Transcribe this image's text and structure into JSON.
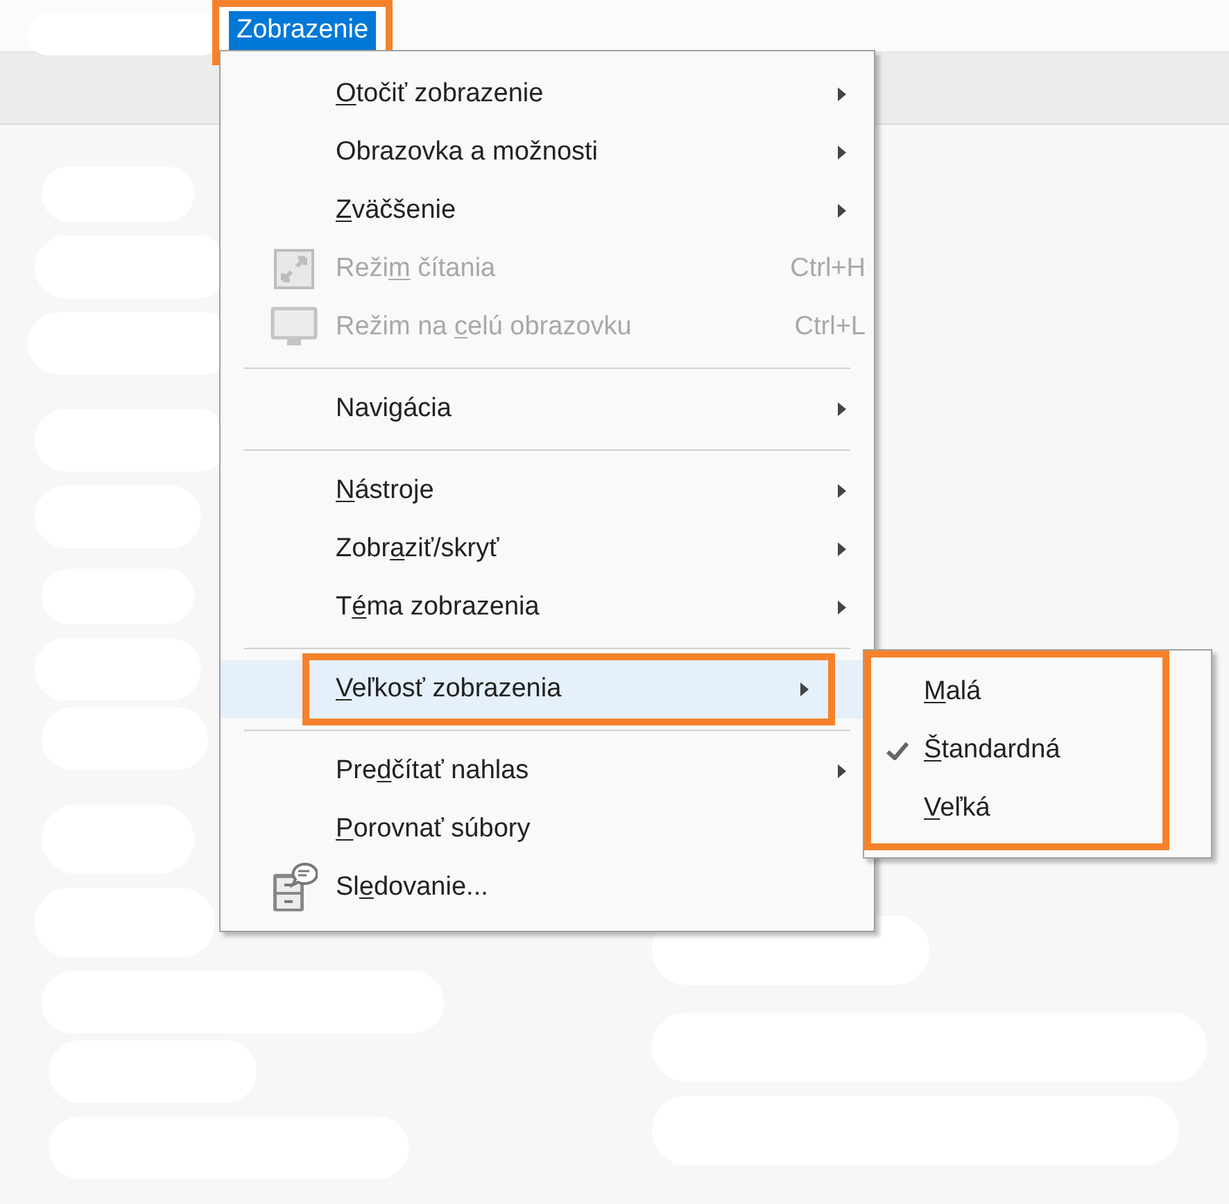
{
  "menu_bar": {
    "items": [
      {
        "label": "Zobrazenie",
        "selected": true,
        "annotated": true
      }
    ]
  },
  "menu": {
    "items": [
      {
        "kind": "item",
        "label_parts": {
          "key": "O",
          "after": "točiť zobrazenie"
        },
        "submenu": true,
        "disabled": false,
        "selected": false
      },
      {
        "kind": "item",
        "label_parts": {
          "before": "Obrazovka a možnosti"
        },
        "submenu": true,
        "disabled": false,
        "selected": false
      },
      {
        "kind": "item",
        "label_parts": {
          "key": "Z",
          "after": "väčšenie"
        },
        "submenu": true,
        "disabled": false,
        "selected": false
      },
      {
        "kind": "item",
        "label_parts": {
          "before": "Reži",
          "key": "m",
          "after": " čítania"
        },
        "shortcut": "Ctrl+H",
        "submenu": false,
        "disabled": true,
        "selected": false
      },
      {
        "kind": "item",
        "label_parts": {
          "before": "Režim na ",
          "key": "c",
          "after": "elú obrazovku"
        },
        "shortcut": "Ctrl+L",
        "submenu": false,
        "disabled": true,
        "selected": false
      },
      {
        "kind": "separator"
      },
      {
        "kind": "item",
        "label_parts": {
          "before": "Navi",
          "key": "g",
          "after": "ácia"
        },
        "submenu": true,
        "disabled": false,
        "selected": false
      },
      {
        "kind": "separator"
      },
      {
        "kind": "item",
        "label_parts": {
          "key": "N",
          "after": "ástroje"
        },
        "submenu": true,
        "disabled": false,
        "selected": false
      },
      {
        "kind": "item",
        "label_parts": {
          "before": "Zobr",
          "key": "a",
          "after": "ziť/skryť"
        },
        "submenu": true,
        "disabled": false,
        "selected": false
      },
      {
        "kind": "item",
        "label_parts": {
          "before": "T",
          "key": "é",
          "after": "ma zobrazenia"
        },
        "submenu": true,
        "disabled": false,
        "selected": false
      },
      {
        "kind": "separator"
      },
      {
        "kind": "item",
        "label_parts": {
          "key": "V",
          "after": "eľkosť zobrazenia"
        },
        "submenu": true,
        "disabled": false,
        "selected": true,
        "annotated": true
      },
      {
        "kind": "separator"
      },
      {
        "kind": "item",
        "label_parts": {
          "before": "Pre",
          "key": "d",
          "after": "čítať nahlas"
        },
        "submenu": true,
        "disabled": false,
        "selected": false
      },
      {
        "kind": "item",
        "label_parts": {
          "key": "P",
          "after": "orovnať súbory"
        },
        "submenu": false,
        "disabled": false,
        "selected": false
      },
      {
        "kind": "item",
        "label_parts": {
          "before": "Sl",
          "key": "e",
          "after": "dovanie..."
        },
        "submenu": false,
        "disabled": false,
        "selected": false
      }
    ]
  },
  "submenu": {
    "annotated": true,
    "items": [
      {
        "label_parts": {
          "key": "M",
          "after": "alá"
        },
        "checked": false
      },
      {
        "label_parts": {
          "key": "Š",
          "after": "tandardná"
        },
        "checked": true
      },
      {
        "label_parts": {
          "key": "V",
          "after": "eľká"
        },
        "checked": false
      }
    ]
  }
}
